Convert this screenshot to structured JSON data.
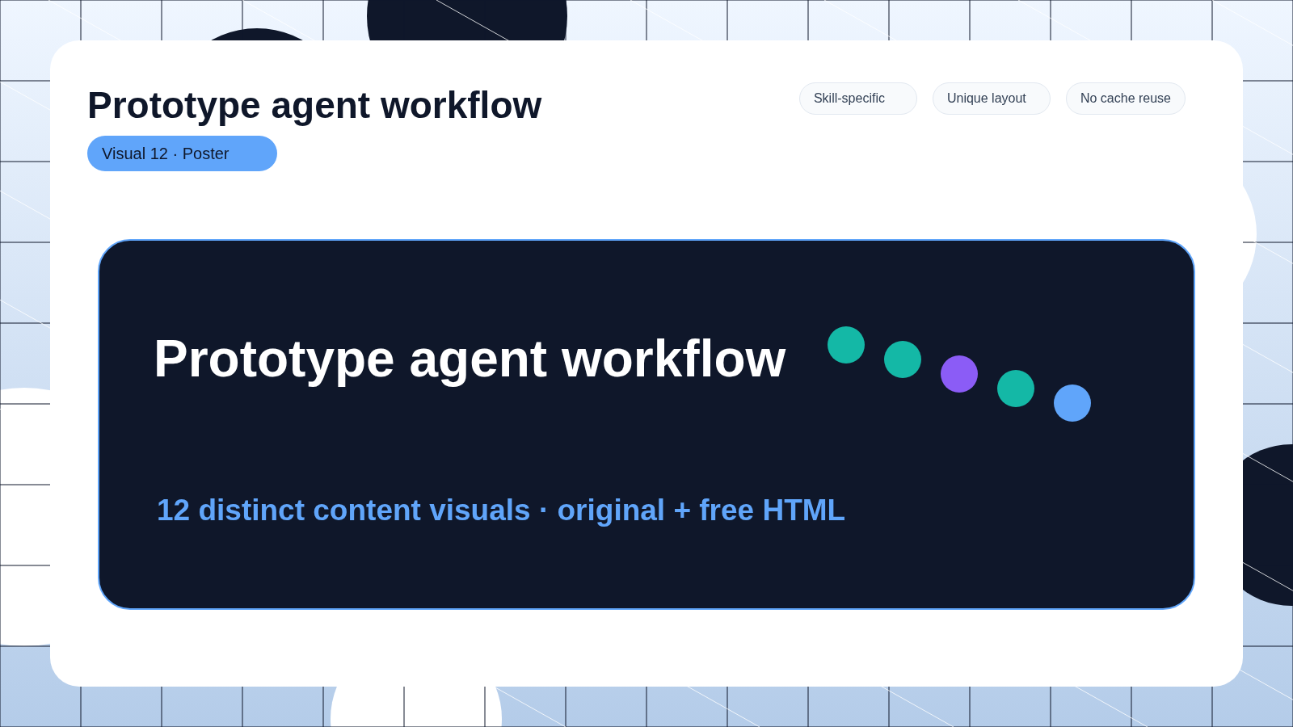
{
  "header": {
    "title": "Prototype agent workflow",
    "badge": "Visual 12 · Poster",
    "chips": [
      "Skill-specific",
      "Unique layout",
      "No cache reuse"
    ]
  },
  "poster": {
    "title": "Prototype agent workflow",
    "subtitle": "12 distinct content visuals · original + free HTML",
    "dots": [
      {
        "color": "#14b8a6"
      },
      {
        "color": "#14b8a6"
      },
      {
        "color": "#8b5cf6"
      },
      {
        "color": "#14b8a6"
      },
      {
        "color": "#60a5fa"
      }
    ]
  }
}
